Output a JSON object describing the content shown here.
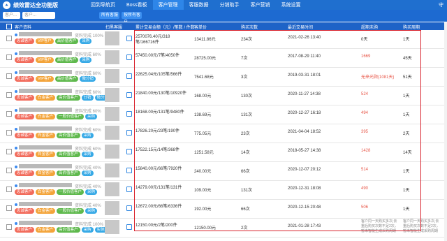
{
  "app": {
    "title": "绩效雷达全功能版",
    "topright": "守"
  },
  "nav": [
    "回到导航页",
    "Boss看板",
    "客户管理",
    "客服数据",
    "分销助手",
    "客户营销",
    "系统设置"
  ],
  "nav_active": 2,
  "filters": {
    "box1": "客户...",
    "box2": "客户...",
    "box3": "所有客服",
    "box4": "按所有客户"
  },
  "headers": [
    "客户资料",
    "扫黑客服",
    "累计交易金额（元）/笔数 / 件数",
    "客单价",
    "购买次数",
    "最近交易时间",
    "超期未购",
    "购买周期"
  ],
  "colors": {
    "topbar": "#1f6fcf",
    "header": "#1e63c7",
    "highlight": "#d8212c",
    "overdue": "#e8584a"
  },
  "rows": [
    {
      "progress": "资料完成 100%",
      "tags": [
        {
          "t": "忠诚客户",
          "c": "red"
        },
        {
          "t": "VIP客户",
          "c": "orange"
        },
        {
          "t": "高价值客户",
          "c": "green"
        },
        {
          "t": "采购",
          "c": "blue"
        }
      ],
      "amount": "2570076.40元/318笔/166716件",
      "price": "13411.86元",
      "count": "234次",
      "date": "2021-02-26 13:40",
      "overdue": "0天",
      "overdue_red": false,
      "cycle": "1天"
    },
    {
      "progress": "资料完成 60%",
      "tags": [
        {
          "t": "忠诚客户",
          "c": "red"
        },
        {
          "t": "VIP客户",
          "c": "orange"
        },
        {
          "t": "高价值客户",
          "c": "green"
        },
        {
          "t": "采购",
          "c": "blue"
        }
      ],
      "amount": "57450.00元/7笔/4050件",
      "price": "28725.00元",
      "count": "7次",
      "date": "2017-08-29 11:40",
      "overdue": "1669",
      "overdue_red": true,
      "cycle": "45天"
    },
    {
      "progress": "资料完成 60%",
      "tags": [
        {
          "t": "忠诚客户",
          "c": "red"
        },
        {
          "t": "VIP客户",
          "c": "orange"
        },
        {
          "t": "高价值客户",
          "c": "green"
        },
        {
          "t": "微分销",
          "c": "blue"
        }
      ],
      "amount": "22625.04元/105笔/566件",
      "price": "7541.68元",
      "count": "3次",
      "date": "2019-03-31 18:01",
      "overdue": "无来光顾(1081天)",
      "overdue_red": true,
      "cycle": "51天"
    },
    {
      "progress": "资料完成 60%",
      "tags": [
        {
          "t": "忠诚客户",
          "c": "red"
        },
        {
          "t": "白金客户",
          "c": "orange"
        },
        {
          "t": "高价值客户",
          "c": "green"
        },
        {
          "t": "分销",
          "c": "blue"
        },
        {
          "t": "微分销",
          "c": "blue"
        }
      ],
      "amount": "21840.00元/130笔/10920件",
      "price": "168.00元",
      "count": "130次",
      "date": "2020-11-27 14:38",
      "overdue": "524",
      "overdue_red": true,
      "cycle": "1天"
    },
    {
      "progress": "资料完成 60%",
      "tags": [
        {
          "t": "忠诚客户",
          "c": "red"
        },
        {
          "t": "白金客户",
          "c": "orange"
        },
        {
          "t": "一般价值客户",
          "c": "green"
        },
        {
          "t": "采购",
          "c": "blue"
        }
      ],
      "amount": "18168.00元/131笔/9480件",
      "price": "138.69元",
      "count": "131次",
      "date": "2020-12-27 16:18",
      "overdue": "494",
      "overdue_red": true,
      "cycle": "1天"
    },
    {
      "progress": "资料完成 60%",
      "tags": [
        {
          "t": "忠诚客户",
          "c": "red"
        },
        {
          "t": "白金客户",
          "c": "orange"
        },
        {
          "t": "高价值客户",
          "c": "green"
        },
        {
          "t": "采购",
          "c": "blue"
        }
      ],
      "amount": "17826.20元/23笔/190件",
      "price": "775.05元",
      "count": "23次",
      "date": "2021-04-04 18:52",
      "overdue": "395",
      "overdue_red": true,
      "cycle": "2天"
    },
    {
      "progress": "资料完成 60%",
      "tags": [
        {
          "t": "忠诚客户",
          "c": "red"
        },
        {
          "t": "白金客户",
          "c": "orange"
        },
        {
          "t": "高价值客户",
          "c": "green"
        },
        {
          "t": "采购",
          "c": "blue"
        }
      ],
      "amount": "17522.15元/14笔/368件",
      "price": "1251.58元",
      "count": "14次",
      "date": "2018-05-27 14:38",
      "overdue": "1428",
      "overdue_red": true,
      "cycle": "14天"
    },
    {
      "progress": "资料完成 40%",
      "tags": [
        {
          "t": "忠诚客户",
          "c": "red"
        },
        {
          "t": "白金客户",
          "c": "orange"
        },
        {
          "t": "高价值客户",
          "c": "green"
        },
        {
          "t": "采购",
          "c": "blue"
        }
      ],
      "amount": "15840.00元/66笔/7920件",
      "price": "240.00元",
      "count": "66次",
      "date": "2020-12-07 20:12",
      "overdue": "514",
      "overdue_red": true,
      "cycle": "1天"
    },
    {
      "progress": "资料完成 40%",
      "tags": [
        {
          "t": "忠诚客户",
          "c": "red"
        },
        {
          "t": "白金客户",
          "c": "orange"
        },
        {
          "t": "一般价值客户",
          "c": "green"
        },
        {
          "t": "采购",
          "c": "blue"
        }
      ],
      "amount": "14279.00元/131笔/131件",
      "price": "109.00元",
      "count": "131次",
      "date": "2020-12-31 18:08",
      "overdue": "490",
      "overdue_red": true,
      "cycle": "1天"
    },
    {
      "progress": "资料完成 40%",
      "tags": [
        {
          "t": "忠诚客户",
          "c": "red"
        },
        {
          "t": "白金客户",
          "c": "orange"
        },
        {
          "t": "一般价值客户",
          "c": "green"
        },
        {
          "t": "采购",
          "c": "blue"
        }
      ],
      "amount": "12672.00元/66笔/6336件",
      "price": "192.00元",
      "count": "66次",
      "date": "2020-12-15 20:48",
      "overdue": "506",
      "overdue_red": true,
      "cycle": "1天"
    },
    {
      "progress": "资料完成 100%",
      "tags": [
        {
          "t": "忠诚客户",
          "c": "red"
        },
        {
          "t": "白金客户",
          "c": "orange"
        },
        {
          "t": "高价值客户",
          "c": "green"
        },
        {
          "t": "采购",
          "c": "blue"
        },
        {
          "t": "实体店主",
          "c": "blue"
        }
      ],
      "amount": "12150.00元/2笔/200件",
      "price": "12150.00元",
      "count": "2次",
      "date": "2021-01-28 17:43",
      "overdue": "客户同一天购买多次,去重后购买次数不足2次，暂未智能生成采购周期",
      "overdue_red": false,
      "cycle": "客户同一天购买多次,去重后购买次数不足2次，暂未智能生成采购周期"
    }
  ]
}
